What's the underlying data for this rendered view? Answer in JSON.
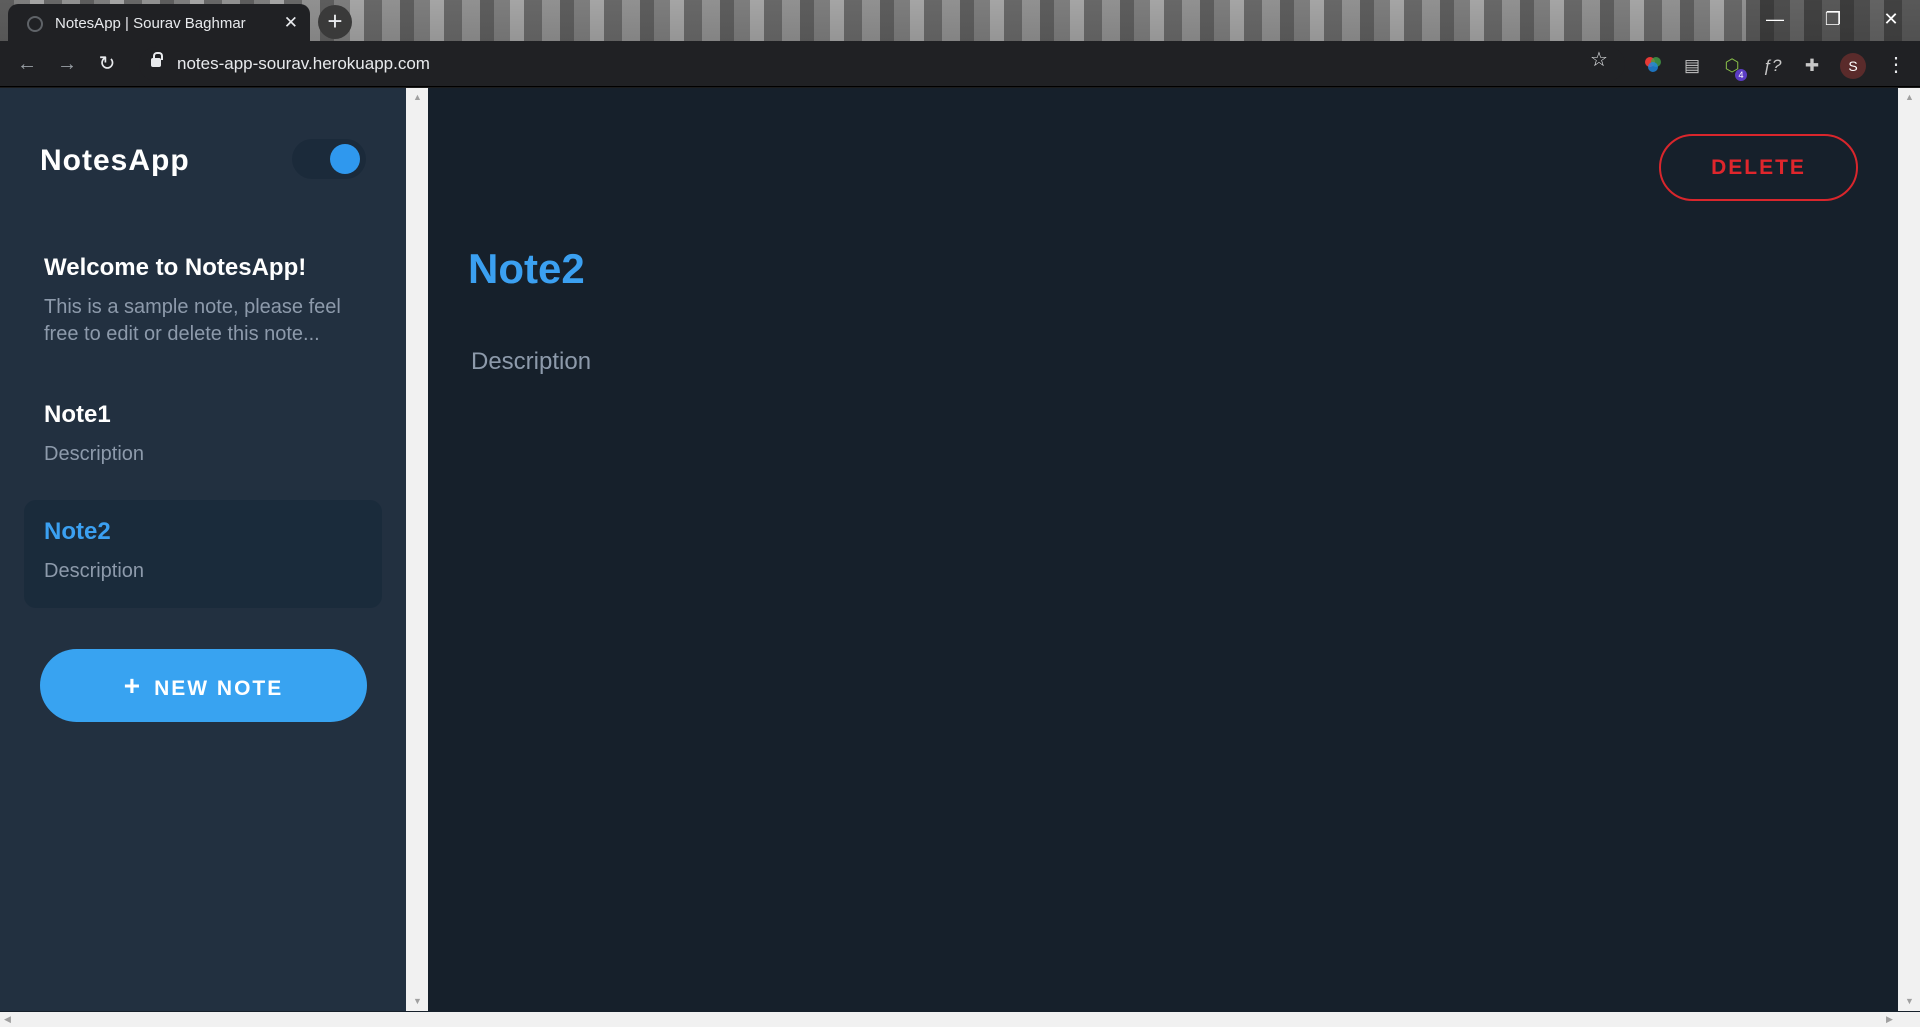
{
  "browser": {
    "tab_title": "NotesApp | Sourav Baghmar",
    "tab_close": "✕",
    "new_tab": "+",
    "url": "notes-app-sourav.herokuapp.com",
    "profile_initial": "S",
    "extension_badge": "4",
    "window_controls": {
      "minimize": "—",
      "restore": "❐",
      "close": "✕"
    }
  },
  "sidebar": {
    "brand": "NotesApp",
    "theme_toggle_on": true,
    "notes": [
      {
        "title": "Welcome to NotesApp!",
        "description": "This is a sample note, please feel free to edit or delete this note..."
      },
      {
        "title": "Note1",
        "description": "Description"
      },
      {
        "title": "Note2",
        "description": "Description",
        "active": true
      }
    ],
    "new_note_label": "NEW NOTE",
    "new_note_icon": "+"
  },
  "editor": {
    "delete_label": "DELETE",
    "title": "Note2",
    "description": "Description"
  },
  "colors": {
    "accent": "#3ba0f1",
    "danger": "#e0262c",
    "sidebar_bg": "#223040",
    "main_bg": "#16202b"
  }
}
